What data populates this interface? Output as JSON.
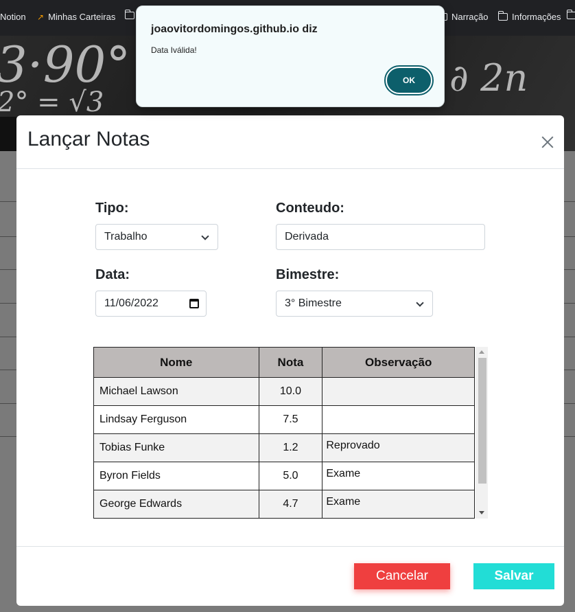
{
  "bookmarks": [
    {
      "label": "Notion",
      "icon": "none"
    },
    {
      "label": "Minhas Carteiras",
      "icon": "trend-icon"
    },
    {
      "label": "",
      "icon": "folder-icon"
    },
    {
      "label": "Narração",
      "icon": "folder-icon"
    },
    {
      "label": "Informações",
      "icon": "folder-icon"
    }
  ],
  "alert": {
    "title": "joaovitordomingos.github.io diz",
    "message": "Data Iválida!",
    "ok_label": "OK"
  },
  "modal": {
    "title": "Lançar Notas",
    "tipo_label": "Tipo:",
    "tipo_value": "Trabalho",
    "conteudo_label": "Conteudo:",
    "conteudo_value": "Derivada",
    "data_label": "Data:",
    "data_value": "11/06/2022",
    "bimestre_label": "Bimestre:",
    "bimestre_value": "3° Bimestre",
    "cancel_label": "Cancelar",
    "save_label": "Salvar"
  },
  "table": {
    "headers": [
      "Nome",
      "Nota",
      "Observação"
    ],
    "rows": [
      {
        "nome": "Michael Lawson",
        "nota": "10.0",
        "obs": ""
      },
      {
        "nome": "Lindsay Ferguson",
        "nota": "7.5",
        "obs": ""
      },
      {
        "nome": "Tobias Funke",
        "nota": "1.2",
        "obs": "Reprovado"
      },
      {
        "nome": "Byron Fields",
        "nota": "5.0",
        "obs": "Exame"
      },
      {
        "nome": "George Edwards",
        "nota": "4.7",
        "obs": "Exame"
      }
    ]
  },
  "colors": {
    "ok_button": "#0d5f6b",
    "cancel_button": "#ef3f3f",
    "save_button": "#22ddd6",
    "table_header": "#bdb9b8"
  }
}
